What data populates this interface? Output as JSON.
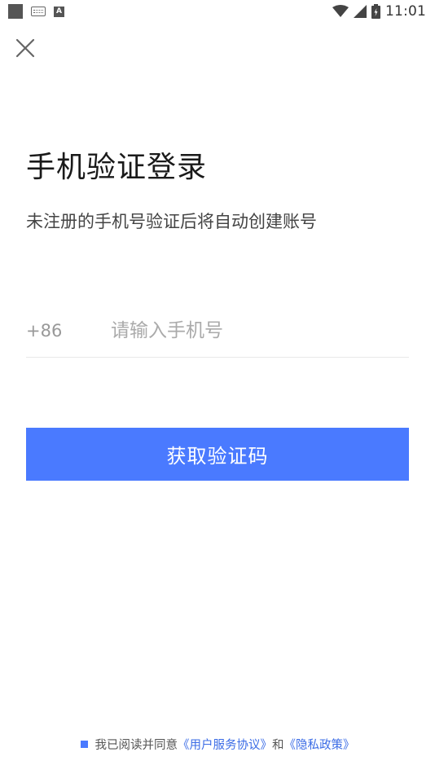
{
  "status_bar": {
    "time": "11:01",
    "left_icons": [
      "square-icon",
      "keyboard-icon",
      "font-a-icon"
    ],
    "right_icons": [
      "wifi-icon",
      "cellular-signal-icon",
      "battery-icon"
    ]
  },
  "header": {
    "close_icon": "close-icon"
  },
  "main": {
    "title": "手机验证登录",
    "subtitle": "未注册的手机号验证后将自动创建账号",
    "phone": {
      "country_code": "+86",
      "placeholder": "请输入手机号",
      "value": ""
    },
    "get_code_button": "获取验证码"
  },
  "footer": {
    "agreement_prefix": "我已阅读并同意",
    "user_agreement_link": "《用户服务协议》",
    "conjunction": "和",
    "privacy_link": "《隐私政策》"
  },
  "colors": {
    "accent": "#4a7aff",
    "link": "#3b6ce6",
    "background": "#ffffff"
  }
}
